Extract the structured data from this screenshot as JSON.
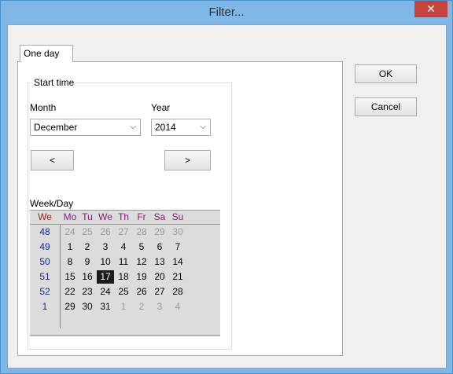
{
  "window": {
    "title": "Filter...",
    "close_glyph": "✕"
  },
  "tab": {
    "label": "One day"
  },
  "group": {
    "label": "Start time"
  },
  "month": {
    "label": "Month",
    "value": "December"
  },
  "year": {
    "label": "Year",
    "value": "2014"
  },
  "nav": {
    "prev": "<",
    "next": ">"
  },
  "calendar": {
    "label": "Week/Day",
    "week_header": "We",
    "day_headers": [
      "Mo",
      "Tu",
      "We",
      "Th",
      "Fr",
      "Sa",
      "Su"
    ],
    "selected_day": "17",
    "rows": [
      {
        "week": "48",
        "days": [
          "24",
          "25",
          "26",
          "27",
          "28",
          "29",
          "30"
        ],
        "outside": [
          true,
          true,
          true,
          true,
          true,
          true,
          true
        ]
      },
      {
        "week": "49",
        "days": [
          "1",
          "2",
          "3",
          "4",
          "5",
          "6",
          "7"
        ],
        "outside": [
          false,
          false,
          false,
          false,
          false,
          false,
          false
        ]
      },
      {
        "week": "50",
        "days": [
          "8",
          "9",
          "10",
          "11",
          "12",
          "13",
          "14"
        ],
        "outside": [
          false,
          false,
          false,
          false,
          false,
          false,
          false
        ]
      },
      {
        "week": "51",
        "days": [
          "15",
          "16",
          "17",
          "18",
          "19",
          "20",
          "21"
        ],
        "outside": [
          false,
          false,
          false,
          false,
          false,
          false,
          false
        ]
      },
      {
        "week": "52",
        "days": [
          "22",
          "23",
          "24",
          "25",
          "26",
          "27",
          "28"
        ],
        "outside": [
          false,
          false,
          false,
          false,
          false,
          false,
          false
        ]
      },
      {
        "week": "1",
        "days": [
          "29",
          "30",
          "31",
          "1",
          "2",
          "3",
          "4"
        ],
        "outside": [
          false,
          false,
          false,
          true,
          true,
          true,
          true
        ]
      }
    ]
  },
  "buttons": {
    "ok": "OK",
    "cancel": "Cancel"
  }
}
